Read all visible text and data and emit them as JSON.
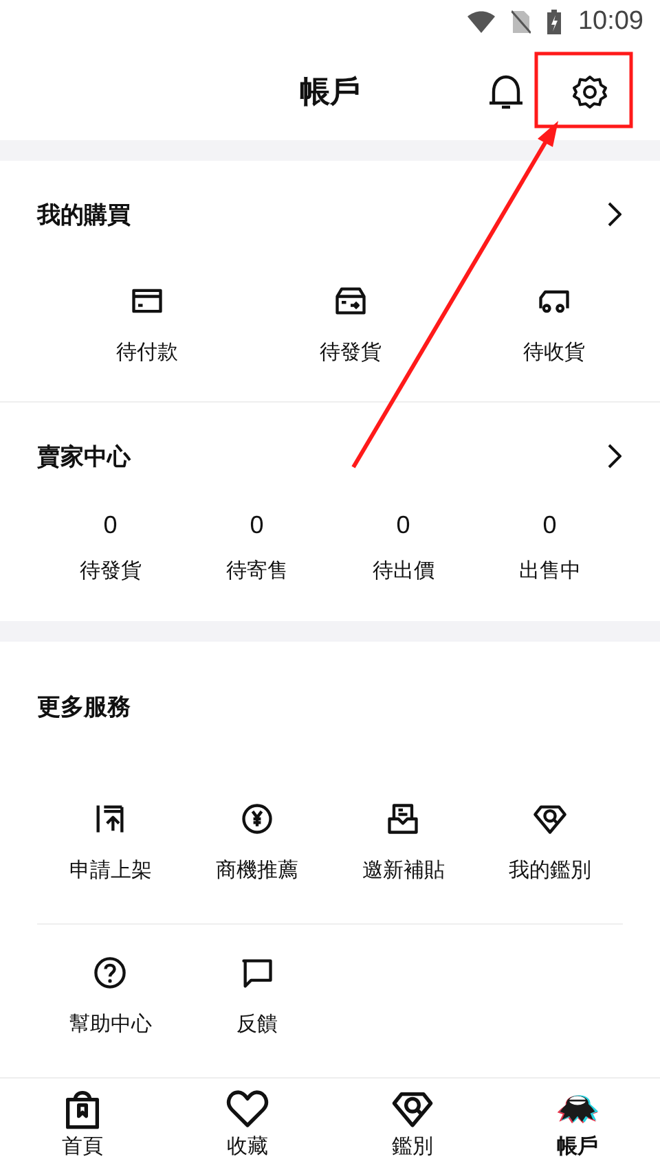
{
  "status_bar": {
    "time": "10:09"
  },
  "header": {
    "title": "帳戶"
  },
  "purchases": {
    "title": "我的購買",
    "items": [
      {
        "label": "待付款"
      },
      {
        "label": "待發貨"
      },
      {
        "label": "待收貨"
      }
    ]
  },
  "seller": {
    "title": "賣家中心",
    "stats": [
      {
        "value": "0",
        "label": "待發貨"
      },
      {
        "value": "0",
        "label": "待寄售"
      },
      {
        "value": "0",
        "label": "待出價"
      },
      {
        "value": "0",
        "label": "出售中"
      }
    ]
  },
  "services": {
    "title": "更多服務",
    "items": [
      {
        "label": "申請上架"
      },
      {
        "label": "商機推薦"
      },
      {
        "label": "邀新補貼"
      },
      {
        "label": "我的鑑別"
      },
      {
        "label": "幫助中心"
      },
      {
        "label": "反饋"
      }
    ]
  },
  "nav": [
    {
      "label": "首頁",
      "selected": false
    },
    {
      "label": "收藏",
      "selected": false
    },
    {
      "label": "鑑別",
      "selected": false
    },
    {
      "label": "帳戶",
      "selected": true
    }
  ]
}
